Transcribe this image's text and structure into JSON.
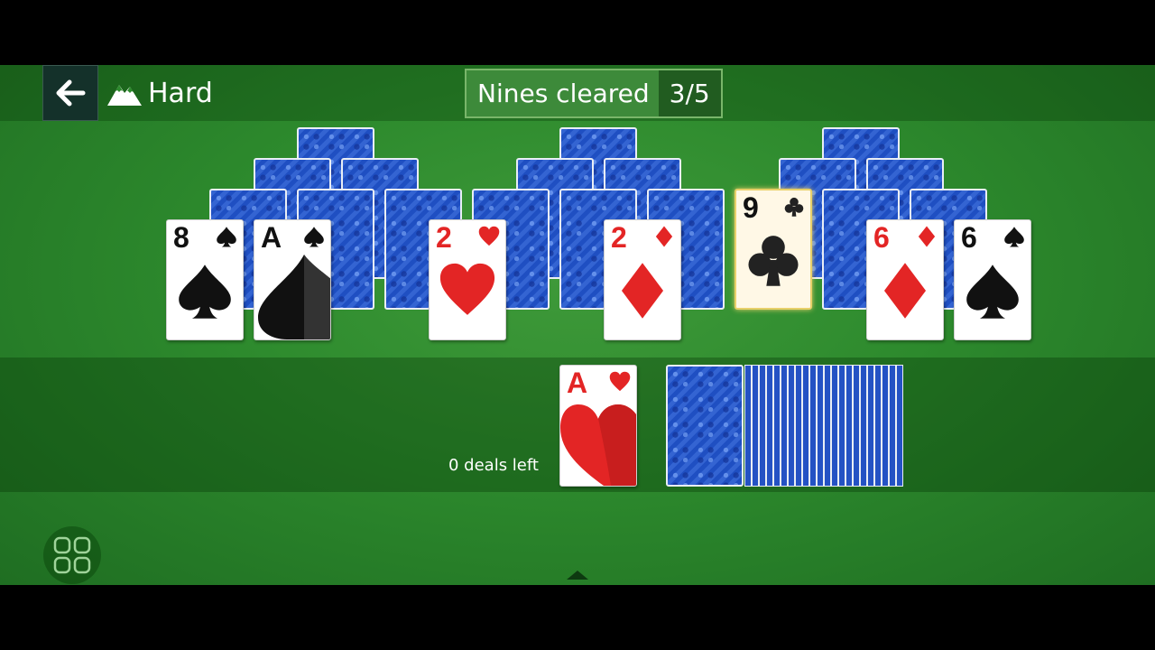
{
  "topbar": {
    "back_icon": "arrow-left-icon",
    "difficulty_icon": "mountain-icon",
    "difficulty_label": "Hard",
    "score_label": "Nines cleared",
    "score_value": "3/5"
  },
  "pyramid": {
    "face_up": [
      {
        "rank": "8",
        "suit": "spades",
        "color": "black"
      },
      {
        "rank": "A",
        "suit": "spades",
        "color": "black"
      },
      {
        "rank": "2",
        "suit": "hearts",
        "color": "red"
      },
      {
        "rank": "2",
        "suit": "diamonds",
        "color": "red"
      },
      {
        "rank": "9",
        "suit": "clubs",
        "color": "black",
        "highlighted": true
      },
      {
        "rank": "6",
        "suit": "diamonds",
        "color": "red"
      },
      {
        "rank": "6",
        "suit": "spades",
        "color": "black"
      }
    ]
  },
  "waste": {
    "rank": "A",
    "suit": "hearts",
    "color": "red"
  },
  "deals_left": "0 deals left",
  "colors": {
    "felt": "#2d8a2d",
    "card_back": "#1f4fc2",
    "red_suit": "#e32525",
    "highlight": "#e8d06a"
  },
  "bottom": {
    "menu_icon": "grid-menu-icon",
    "chevron_icon": "chevron-up-icon"
  }
}
